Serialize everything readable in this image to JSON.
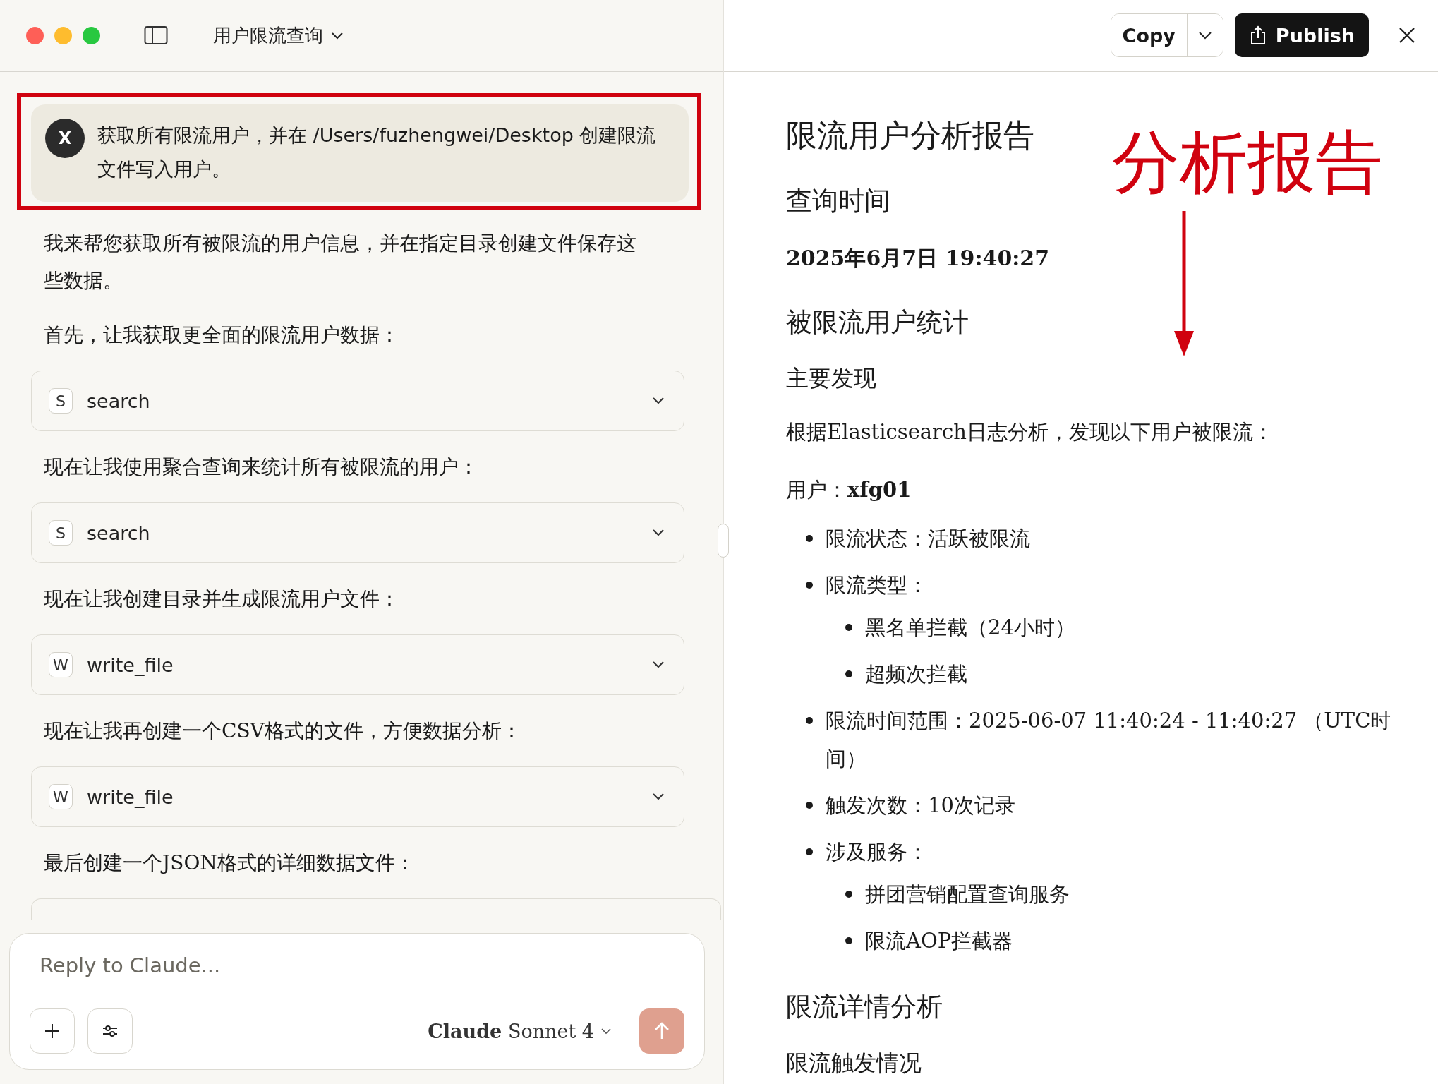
{
  "window": {
    "title": "用户限流查询"
  },
  "toolbar": {
    "copy": "Copy",
    "publish": "Publish"
  },
  "user_message": {
    "avatar": "X",
    "text": "获取所有限流用户，并在 /Users/fuzhengwei/Desktop 创建限流文件写入用户。",
    "highlighted": true
  },
  "conversation": [
    {
      "kind": "text",
      "text": "我来帮您获取所有被限流的用户信息，并在指定目录创建文件保存这些数据。"
    },
    {
      "kind": "text",
      "text": "首先，让我获取更全面的限流用户数据："
    },
    {
      "kind": "tool",
      "letter": "S",
      "name": "search"
    },
    {
      "kind": "text",
      "text": "现在让我使用聚合查询来统计所有被限流的用户："
    },
    {
      "kind": "tool",
      "letter": "S",
      "name": "search"
    },
    {
      "kind": "text",
      "text": "现在让我创建目录并生成限流用户文件："
    },
    {
      "kind": "tool",
      "letter": "W",
      "name": "write_file"
    },
    {
      "kind": "text",
      "text": "现在让我再创建一个CSV格式的文件，方便数据分析："
    },
    {
      "kind": "tool",
      "letter": "W",
      "name": "write_file"
    },
    {
      "kind": "text",
      "text": "最后创建一个JSON格式的详细数据文件："
    },
    {
      "kind": "tool_partial"
    }
  ],
  "composer": {
    "placeholder": "Reply to Claude...",
    "model": "**Claude** Sonnet 4"
  },
  "report": {
    "blocks": [
      {
        "kind": "title",
        "text": "限流用户分析报告"
      },
      {
        "kind": "h2",
        "text": "查询时间"
      },
      {
        "kind": "strong",
        "text": "2025年6月7日 19:40:27"
      },
      {
        "kind": "h2",
        "text": "被限流用户统计"
      },
      {
        "kind": "h3",
        "text": "主要发现"
      },
      {
        "kind": "para",
        "text": "根据Elasticsearch日志分析，发现以下用户被限流："
      },
      {
        "kind": "user",
        "text": "用户：**xfg01**"
      },
      {
        "kind": "list",
        "items": [
          {
            "text": "限流状态：活跃被限流"
          },
          {
            "text": "限流类型：",
            "children": [
              {
                "text": "黑名单拦截（24小时）"
              },
              {
                "text": "超频次拦截"
              }
            ]
          },
          {
            "text": "限流时间范围：2025-06-07 11:40:24 - 11:40:27 （UTC时间）"
          },
          {
            "text": "触发次数：10次记录"
          },
          {
            "text": "涉及服务：",
            "children": [
              {
                "text": "拼团营销配置查询服务"
              },
              {
                "text": "限流AOP拦截器"
              }
            ]
          }
        ]
      },
      {
        "kind": "h2",
        "text": "限流详情分析"
      },
      {
        "kind": "h3",
        "text": "限流触发情况"
      }
    ]
  },
  "annotation": {
    "text": "分析报告"
  }
}
